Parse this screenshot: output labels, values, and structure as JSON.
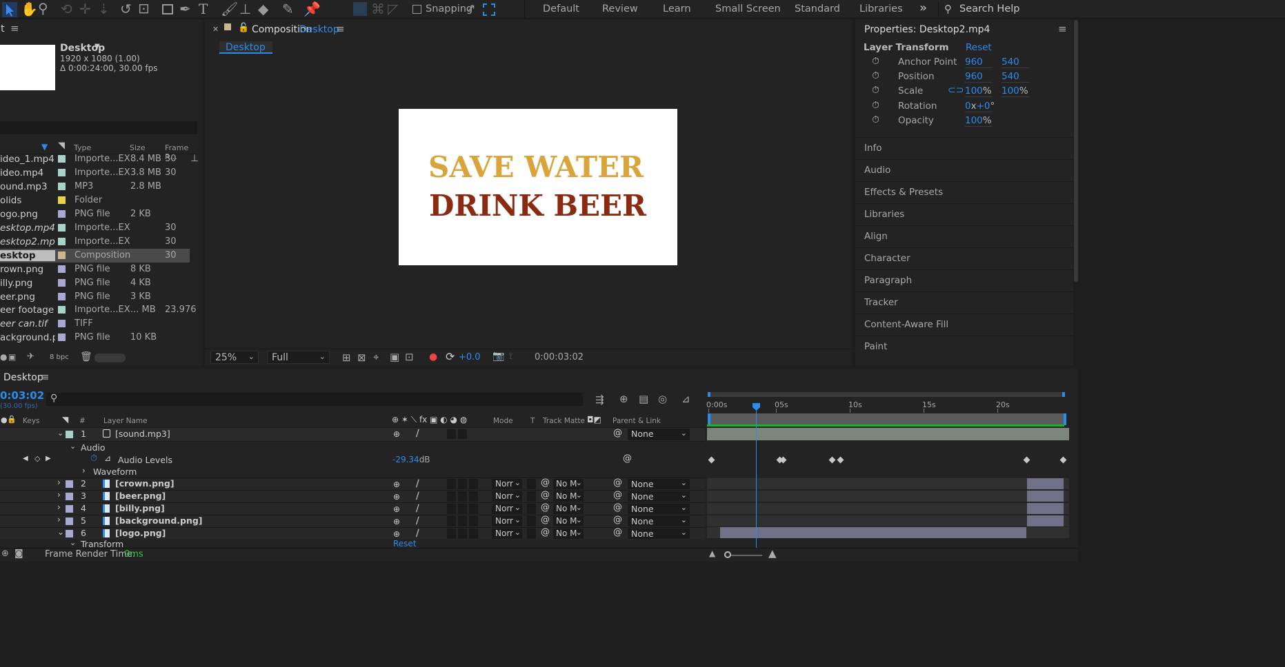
{
  "toolbar": {
    "snapping_label": "Snapping",
    "workspaces": [
      "Default",
      "Review",
      "Learn",
      "Small Screen",
      "Standard",
      "Libraries"
    ],
    "overflow": "»",
    "search_placeholder": "Search Help"
  },
  "project": {
    "tab_partial": "t",
    "comp_name": "Desktop",
    "comp_res": "1920 x 1080 (1.00)",
    "comp_dur": "Δ 0:00:24:00, 30.00 fps",
    "columns": {
      "type": "Type",
      "size": "Size",
      "frame_rate": "Frame R..."
    },
    "items": [
      {
        "name": "ideo_1.mp4",
        "type": "Importe...EX",
        "size": "8.4 MB",
        "fps": "30",
        "color": "#a7d3c9"
      },
      {
        "name": "ideo.mp4",
        "type": "Importe...EX",
        "size": "3.8 MB",
        "fps": "30",
        "color": "#a7d3c9"
      },
      {
        "name": "ound.mp3",
        "type": "MP3",
        "size": "2.8 MB",
        "fps": "",
        "color": "#a7d3c9"
      },
      {
        "name": "olids",
        "type": "Folder",
        "size": "",
        "fps": "",
        "color": "#e5d546"
      },
      {
        "name": "ogo.png",
        "type": "PNG file",
        "size": "2 KB",
        "fps": "",
        "color": "#a8a8d2"
      },
      {
        "name": "esktop.mp4",
        "type": "Importe...EX",
        "size": "",
        "fps": "30",
        "color": "#a7d3c9"
      },
      {
        "name": "esktop2.mp4",
        "type": "Importe...EX",
        "size": "",
        "fps": "30",
        "color": "#a7d3c9"
      },
      {
        "name": "esktop",
        "type": "Composition",
        "size": "",
        "fps": "30",
        "color": "#cdb58c"
      },
      {
        "name": "rown.png",
        "type": "PNG file",
        "size": "8 KB",
        "fps": "",
        "color": "#a8a8d2"
      },
      {
        "name": "illy.png",
        "type": "PNG file",
        "size": "4 KB",
        "fps": "",
        "color": "#a8a8d2"
      },
      {
        "name": "eer.png",
        "type": "PNG file",
        "size": "3 KB",
        "fps": "",
        "color": "#a8a8d2"
      },
      {
        "name": "eer footage",
        "type": "Importe...EX",
        "size": "... MB",
        "fps": "23.976",
        "color": "#a7d3c9"
      },
      {
        "name": "eer can.tif",
        "type": "TIFF",
        "size": "",
        "fps": "",
        "color": "#a8a8d2"
      },
      {
        "name": "ackground.png",
        "type": "PNG file",
        "size": "10 KB",
        "fps": "",
        "color": "#a8a8d2"
      }
    ],
    "bpc": "8 bpc"
  },
  "composition": {
    "tab_prefix": "Composition",
    "tab_name": "Desktop",
    "breadcrumb": "Desktop",
    "line1": "SAVE WATER",
    "line2": "DRINK BEER",
    "zoom": "25%",
    "quality": "Full",
    "exposure": "+0.0",
    "timecode": "0:00:03:02"
  },
  "properties": {
    "title": "Properties: Desktop2.mp4",
    "section": "Layer Transform",
    "reset": "Reset",
    "rows": [
      {
        "label": "Anchor Point",
        "v1": "960",
        "v2": "540"
      },
      {
        "label": "Position",
        "v1": "960",
        "v2": "540"
      },
      {
        "label": "Scale",
        "v1": "100",
        "v2": "100"
      },
      {
        "label": "Rotation",
        "v1": "0",
        "v2": "+0"
      },
      {
        "label": "Opacity",
        "v1": "100",
        "v2": ""
      }
    ],
    "pct": "%",
    "rot_x": "x",
    "deg": "°",
    "panels": [
      "Info",
      "Audio",
      "Effects & Presets",
      "Libraries",
      "Align",
      "Character",
      "Paragraph",
      "Tracker",
      "Content-Aware Fill",
      "Paint"
    ]
  },
  "timeline": {
    "tab": "Desktop",
    "timecode": "0:03:02",
    "fps": "(30.00 fps)",
    "cols": {
      "keys": "Keys",
      "num": "#",
      "layer": "Layer Name",
      "mode": "Mode",
      "t": "T",
      "matte": "Track Matte",
      "parent": "Parent & Link"
    },
    "ruler": [
      "0:00s",
      "05s",
      "10s",
      "15s",
      "20s"
    ],
    "layer1": {
      "num": "1",
      "name": "[sound.mp3]",
      "parent": "None"
    },
    "audio_group": "Audio",
    "audio_levels": "Audio Levels",
    "audio_value": "-29.34",
    "db": "dB",
    "waveform": "Waveform",
    "layers": [
      {
        "num": "2",
        "name": "[crown.png]",
        "mode": "Norr",
        "matte": "No M",
        "parent": "None"
      },
      {
        "num": "3",
        "name": "[beer.png]",
        "mode": "Norr",
        "matte": "No M",
        "parent": "None"
      },
      {
        "num": "4",
        "name": "[billy.png]",
        "mode": "Norr",
        "matte": "No M",
        "parent": "None"
      },
      {
        "num": "5",
        "name": "[background.png]",
        "mode": "Norr",
        "matte": "No M",
        "parent": "None"
      },
      {
        "num": "6",
        "name": "[logo.png]",
        "mode": "Norr",
        "matte": "No M",
        "parent": "None"
      }
    ],
    "transform": "Transform",
    "transform_reset": "Reset",
    "render_label": "Frame Render Time:",
    "render_value": "0ms"
  }
}
